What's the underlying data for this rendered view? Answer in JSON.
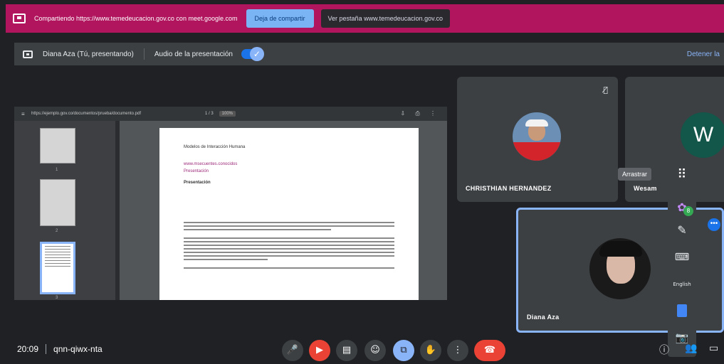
{
  "share_banner": {
    "text": "Compartiendo https://www.temedeucacion.gov.co con meet.google.com",
    "stop_share_label": "Deja de compartir",
    "switch_tab_label": "Ver pestaña www.temedeucacion.gov.co"
  },
  "presenting": {
    "name": "Diana Aza (Tú, presentando)",
    "audio_label": "Audio de la presentación",
    "audio_enabled": true,
    "stop_label": "Detener la"
  },
  "pdf_viewer": {
    "file_name": "https://ejemplo.gov.co/documentos/prueba/documento.pdf",
    "page_indicator": "1 / 3",
    "zoom": "100%",
    "thumbnail_numbers": [
      "1",
      "2",
      "3"
    ],
    "page": {
      "header": "Modelos de Interacción Humana",
      "link_text": "www.msecuentes.conocidos",
      "subtitle": "Presentación",
      "title": "Presentación"
    }
  },
  "participants": [
    {
      "name": "CHRISTHIAN HERNANDEZ",
      "muted": true
    },
    {
      "name": "Wesam",
      "initial": "W"
    },
    {
      "name": "Diana Aza"
    }
  ],
  "side_toolbar": {
    "tooltip": "Arrastrar",
    "badge": "8",
    "caption_label": "English"
  },
  "bottom_bar": {
    "time": "20:09",
    "meeting_code": "qnn-qiwx-nta",
    "more_label": "⋮"
  },
  "colors": {
    "banner": "#b0155e",
    "accent": "#1a73e8",
    "danger": "#ea4335",
    "background": "#202124"
  }
}
